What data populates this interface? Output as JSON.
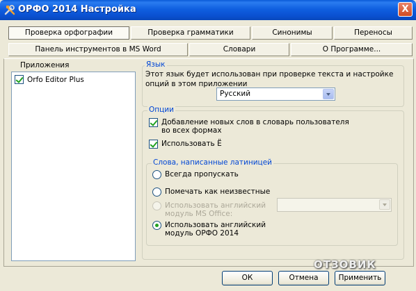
{
  "window": {
    "title": "ОРФО 2014 Настройка",
    "close_label": "X",
    "icon": "tools-icon"
  },
  "tabs": {
    "row1": [
      {
        "label": "Проверка орфографии",
        "active": true
      },
      {
        "label": "Проверка грамматики",
        "active": false
      },
      {
        "label": "Синонимы",
        "active": false
      },
      {
        "label": "Переносы",
        "active": false
      }
    ],
    "row2": [
      {
        "label": "Панель инструментов в MS Word",
        "active": false
      },
      {
        "label": "Словари",
        "active": false
      },
      {
        "label": "О Программе...",
        "active": false
      }
    ]
  },
  "applications": {
    "label": "Приложения",
    "items": [
      {
        "label": "Orfo Editor Plus",
        "checked": true
      }
    ]
  },
  "language": {
    "group_title": "Язык",
    "description": "Этот язык будет использован при проверке текста и настройке опций в этом приложении",
    "selected": "Русский"
  },
  "options": {
    "group_title": "Опции",
    "add_words_label": "Добавление новых слов в словарь пользователя во всех формах",
    "add_words_checked": true,
    "use_yo_label": "Использовать Ё",
    "use_yo_checked": true
  },
  "latin": {
    "group_title": "Слова, написанные латиницей",
    "always_skip": "Всегда пропускать",
    "mark_unknown": "Помечать как неизвестные",
    "use_english_ms": "Использовать английский модуль MS Office:",
    "use_english_orfo": "Использовать английский модуль ОРФО 2014",
    "selected": "use_english_orfo"
  },
  "buttons": {
    "ok": "ОК",
    "cancel": "Отмена",
    "apply": "Применить"
  },
  "watermark": "ОТЗОВИК",
  "colors": {
    "titlebar": "#0a50d0",
    "dialog_bg": "#ece9d8",
    "group_title": "#0046d5",
    "check_mark": "#21a121"
  }
}
